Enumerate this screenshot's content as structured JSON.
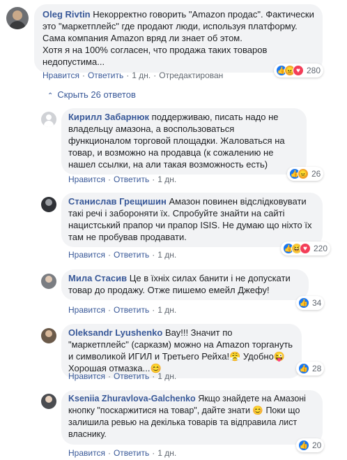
{
  "top_comment": {
    "author": "Oleg Rivtin",
    "text": "Некорректно говорить \"Amazon продас\". Фактически это \"маркетплейс\" где продают люди, используя платформу. Сама компания Amazon вряд ли знает об этом.\nХотя я на 100% согласен, что продажа таких товаров недопустима...",
    "like_label": "Нравится",
    "reply_label": "Ответить",
    "time": "1 дн.",
    "edited": "Отредактирован",
    "reaction_count": "280",
    "reactions": [
      "like-icon",
      "angry-icon",
      "love-icon"
    ]
  },
  "hide_replies": {
    "icon": "chevron-up-icon",
    "label": "Скрыть 26 ответов"
  },
  "replies": [
    {
      "author": "Кирилл Забарнюк",
      "text": "поддерживаю, писать надо не владельцу амазона, а воспользоваться функционалом торговой площадки. Жаловаться на товар, и возможно на продавца (к сожалению не нашел ссылки, на али такая возможность есть)",
      "like_label": "Нравится",
      "reply_label": "Ответить",
      "time": "1 дн.",
      "reaction_count": "26",
      "reactions": [
        "like-icon",
        "angry-icon"
      ]
    },
    {
      "author": "Станислав Грещишин",
      "text": "Амазон повинен відслідковувати такі речі і забороняти їх. Спробуйте знайти на сайті нацистський прапор чи прапор ISIS. Не думаю що ніхто їх там не пробував продавати.",
      "like_label": "Нравится",
      "reply_label": "Ответить",
      "time": "1 дн.",
      "reaction_count": "220",
      "reactions": [
        "like-icon",
        "haha-icon",
        "love-icon"
      ]
    },
    {
      "author": "Мила Стасив",
      "text": "Це в їхніх силах банити і не допускати товар до продажу. Отже пишемо емейл Джефу!",
      "like_label": "Нравится",
      "reply_label": "Ответить",
      "time": "1 дн.",
      "reaction_count": "34",
      "reactions": [
        "like-icon"
      ]
    },
    {
      "author": "Oleksandr Lyushenko",
      "text": "Вау!!! Значит по \"маркетплейс\" (сарказм) можно на Amazon торгануть и символикой ИГИЛ и Третьего Рейха!😤 Удобно😜 Хорошая отмазка...😊",
      "like_label": "Нравится",
      "reply_label": "Ответить",
      "time": "1 дн.",
      "reaction_count": "28",
      "reactions": [
        "like-icon"
      ]
    },
    {
      "author": "Kseniia Zhuravlova-Galchenko",
      "text": "Якщо знайдете на Амазоні кнопку \"поскаржитися на товар\", дайте знати 😊 Поки що залишила ревью на декілька товарів та відправила лист власнику.",
      "like_label": "Нравится",
      "reply_label": "Ответить",
      "time": "1 дн.",
      "reaction_count": "20",
      "reactions": [
        "like-icon"
      ]
    }
  ],
  "colors": {
    "link": "#385898",
    "bubble": "#f2f3f5",
    "like": "#1877f2"
  }
}
